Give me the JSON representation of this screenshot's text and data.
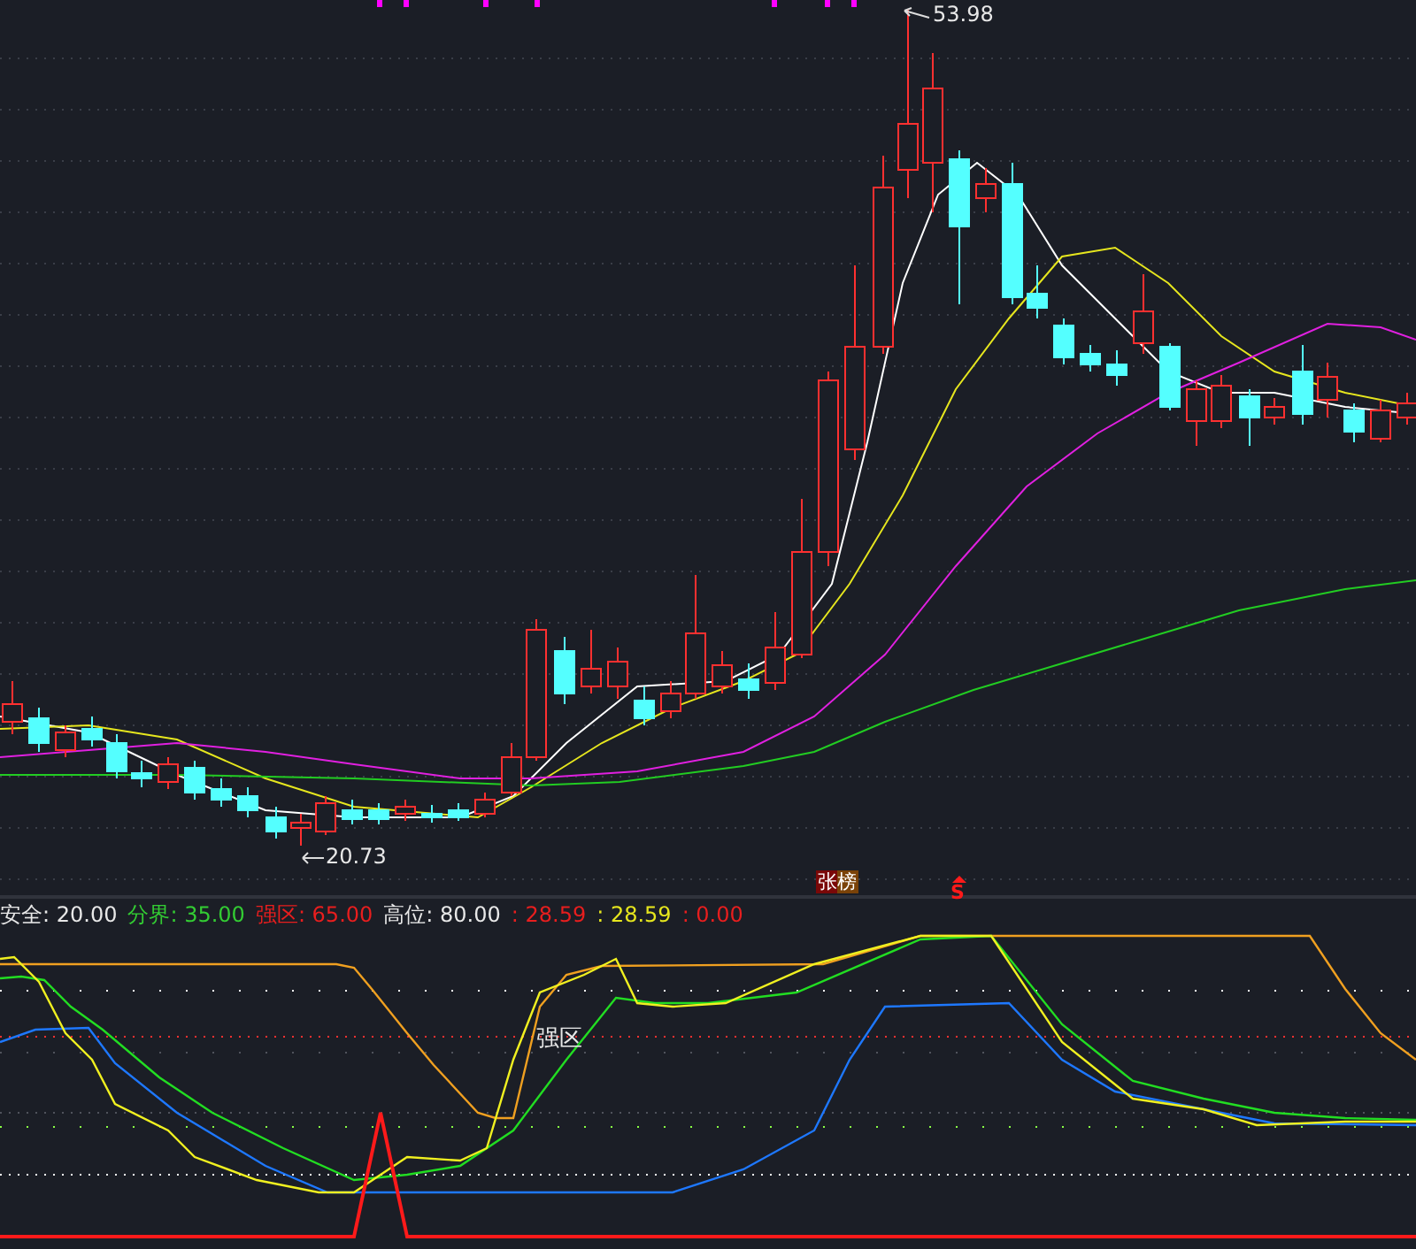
{
  "price_chart": {
    "high_label": "53.98",
    "low_label": "20.73",
    "badge": "张榜",
    "signal": "S"
  },
  "indicator": {
    "legend": [
      {
        "text": "安全: 20.00",
        "color": "#e8e8e8"
      },
      {
        "text": "分界: 35.00",
        "color": "#33cc33"
      },
      {
        "text": "强区: 65.00",
        "color": "#e81e1e"
      },
      {
        "text": "高位: 80.00",
        "color": "#e8e8e8"
      },
      {
        "text": ": 28.59",
        "color": "#e81e1e"
      },
      {
        "text": ": 28.59",
        "color": "#e6e61e"
      },
      {
        "text": ": 0.00",
        "color": "#e81e1e"
      }
    ],
    "zone_label": "强区"
  }
}
